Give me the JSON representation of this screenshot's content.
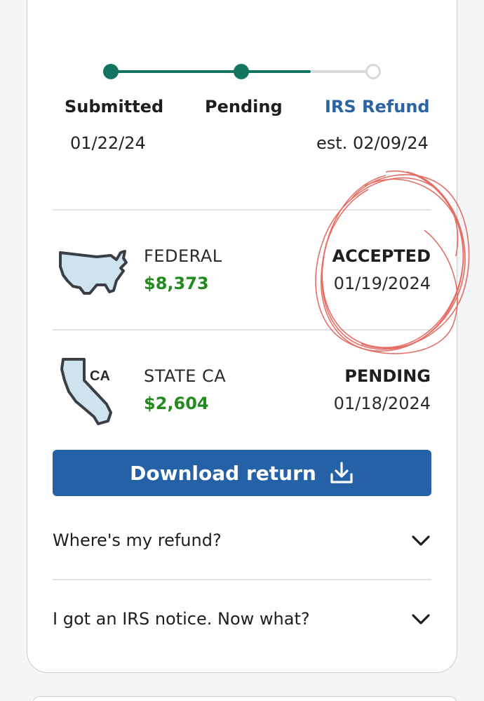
{
  "tracker": {
    "steps": [
      {
        "label": "Submitted",
        "date": "01/22/24"
      },
      {
        "label": "Pending",
        "date": ""
      },
      {
        "label": "IRS Refund",
        "date": "est. 02/09/24"
      }
    ]
  },
  "returns": [
    {
      "name": "FEDERAL",
      "amount": "$8,373",
      "status": "ACCEPTED",
      "date": "01/19/2024",
      "icon": "us-map-icon"
    },
    {
      "name": "STATE CA",
      "amount": "$2,604",
      "status": "PENDING",
      "date": "01/18/2024",
      "icon": "california-map-icon",
      "icon_text": "CA"
    }
  ],
  "download_button": {
    "label": "Download return",
    "icon": "download-icon"
  },
  "faq": [
    {
      "question": "Where's my refund?",
      "icon": "chevron-down-icon"
    },
    {
      "question": "I got an IRS notice. Now what?",
      "icon": "chevron-down-icon"
    }
  ],
  "colors": {
    "accent_green": "#13745f",
    "amount_green": "#238a1f",
    "active_blue": "#2b63a3",
    "button_blue": "#2461a6",
    "annotation_red": "#e0564c"
  }
}
